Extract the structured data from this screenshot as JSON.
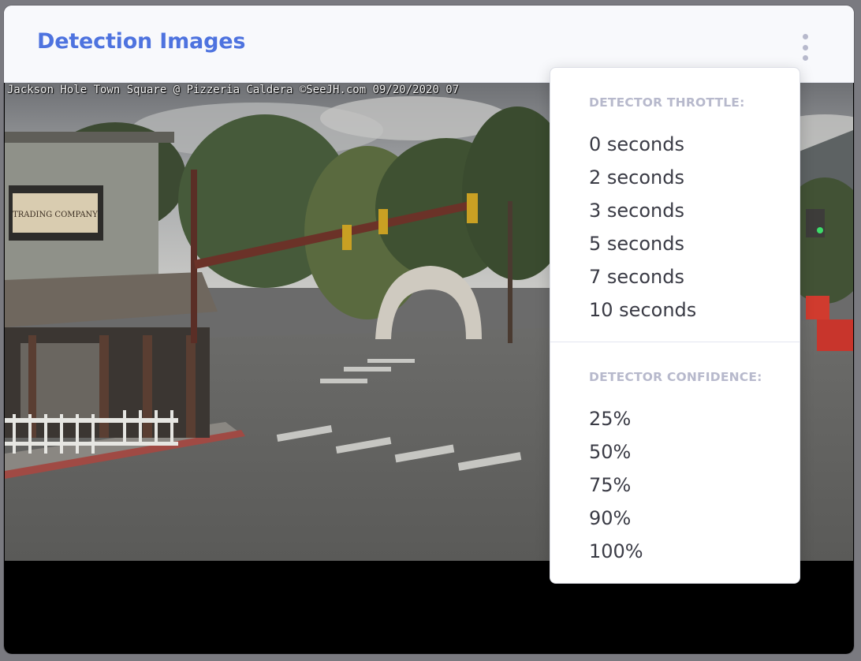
{
  "card": {
    "title": "Detection Images",
    "menu_icon": "vertical-ellipsis-icon",
    "accent_color": "#4e73df"
  },
  "camera": {
    "overlay_text": "Jackson Hole Town Square @ Pizzeria Caldera ©SeeJH.com 09/20/2020 07",
    "sign_text": "TRADING COMPANY"
  },
  "dropdown": {
    "throttle_header": "DETECTOR THROTTLE:",
    "throttle_options": [
      "0 seconds",
      "2 seconds",
      "3 seconds",
      "5 seconds",
      "7 seconds",
      "10 seconds"
    ],
    "confidence_header": "DETECTOR CONFIDENCE:",
    "confidence_options": [
      "25%",
      "50%",
      "75%",
      "90%",
      "100%"
    ]
  }
}
